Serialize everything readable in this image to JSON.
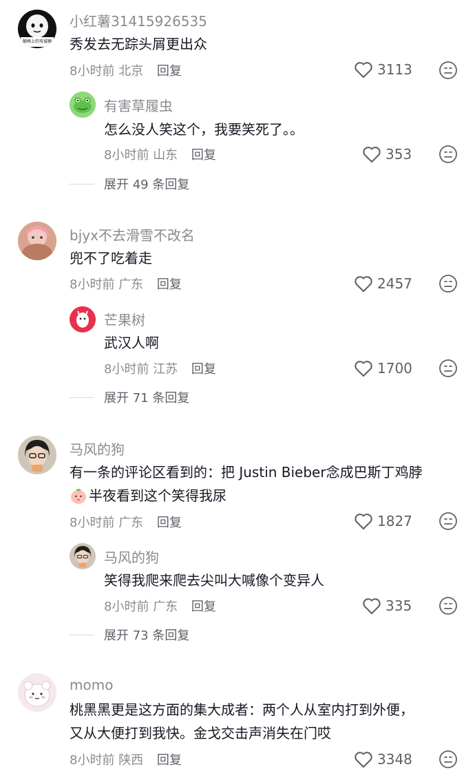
{
  "comments": [
    {
      "username": "小红薯31415926535",
      "avatar_caption": "躺椅上的攻城狮",
      "text": [
        "秀发去无踪头屑更出众"
      ],
      "time": "8小时前",
      "location": "北京",
      "reply_label": "回复",
      "likes": "3113",
      "reply": {
        "username": "有害草履虫",
        "text": "怎么没人笑这个，我要笑死了。。",
        "time": "8小时前",
        "location": "山东",
        "reply_label": "回复",
        "likes": "353"
      },
      "expand_label": "展开 49 条回复"
    },
    {
      "username": "bjyx不去滑雪不改名",
      "text": [
        "兜不了吃着走"
      ],
      "time": "8小时前",
      "location": "广东",
      "reply_label": "回复",
      "likes": "2457",
      "reply": {
        "username": "芒果树",
        "text": "武汉人啊",
        "time": "8小时前",
        "location": "江苏",
        "reply_label": "回复",
        "likes": "1700"
      },
      "expand_label": "展开 71 条回复"
    },
    {
      "username": "马风的狗",
      "text": [
        "有一条的评论区看到的：把 Justin Bieber念成巴斯丁鸡脖",
        "半夜看到这个笑得我尿"
      ],
      "time": "8小时前",
      "location": "广东",
      "reply_label": "回复",
      "likes": "1827",
      "reply": {
        "username": "马风的狗",
        "text": "笑得我爬来爬去尖叫大喊像个变异人",
        "time": "8小时前",
        "location": "广东",
        "reply_label": "回复",
        "likes": "335"
      },
      "expand_label": "展开 73 条回复"
    },
    {
      "username": "momo",
      "text": [
        "桃黑黑更是这方面的集大成者：两个人从室内打到外便，",
        "又从大便打到我快。金戈交击声消失在门哎"
      ],
      "time": "8小时前",
      "location": "陕西",
      "reply_label": "回复",
      "likes": "3348"
    }
  ],
  "colors": {
    "text": "#161823",
    "secondary": "#8a8b91",
    "icon": "#5f6068"
  },
  "icons": {
    "like": "heart-outline-icon",
    "dislike": "meh-face-icon",
    "emoji": "peach-emoji-icon"
  }
}
